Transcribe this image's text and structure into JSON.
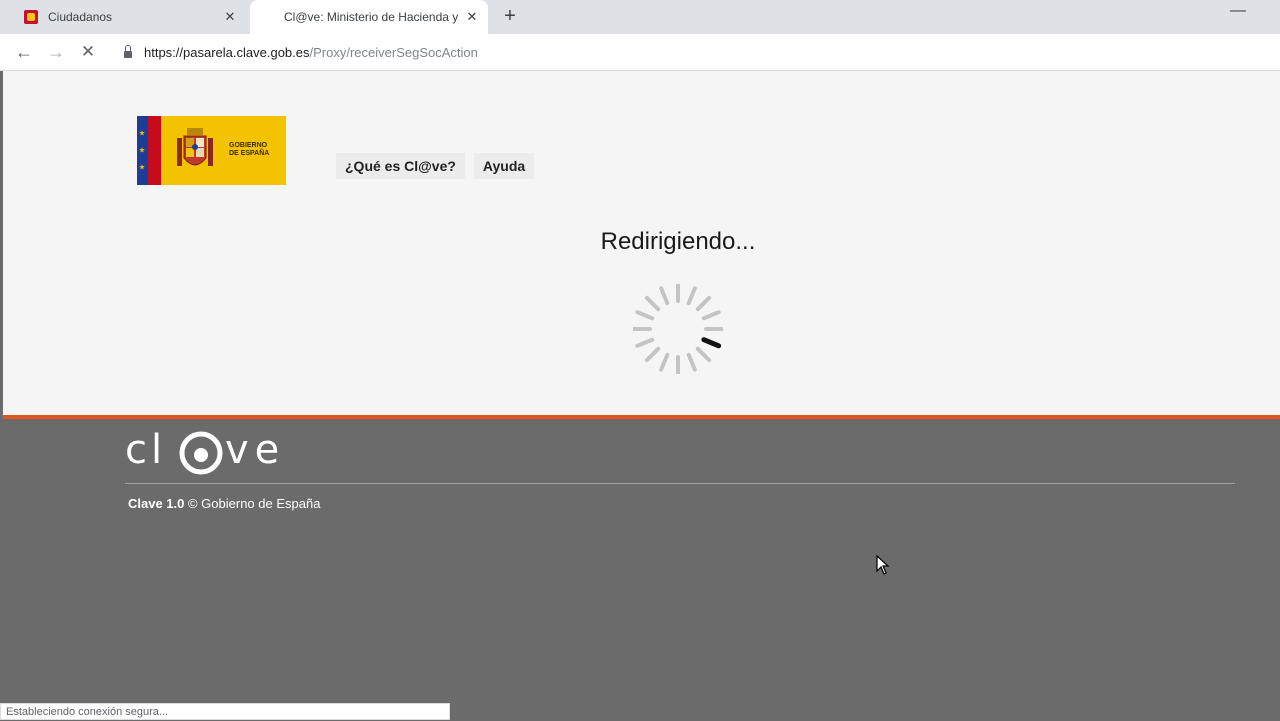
{
  "browser": {
    "tabs": [
      {
        "title": "Ciudadanos",
        "close": "✕",
        "active": false
      },
      {
        "title": "Cl@ve: Ministerio de Hacienda y",
        "close": "✕",
        "active": true
      }
    ],
    "new_tab": "+",
    "minimize": "—",
    "nav": {
      "back": "←",
      "forward": "→",
      "stop": "✕"
    },
    "url": {
      "host": "https://pasarela.clave.gob.es",
      "path": "/Proxy/receiverSegSocAction"
    },
    "status": "Estableciendo conexión segura..."
  },
  "header": {
    "logo_text_line1": "GOBIERNO",
    "logo_text_line2": "DE ESPAÑA",
    "links": [
      "¿Qué es Cl@ve?",
      "Ayuda"
    ]
  },
  "main": {
    "heading": "Redirigiendo...",
    "spinner_icon": "loading-spinner-icon"
  },
  "footer": {
    "logo_text": "cl@ve",
    "copyright_bold": "Clave 1.0",
    "copyright_rest": " © Gobierno de España"
  },
  "colors": {
    "accent": "#e0561d",
    "footer_bg": "#6b6b6b",
    "content_bg": "#f5f5f5",
    "logo_yellow": "#f3c300"
  }
}
